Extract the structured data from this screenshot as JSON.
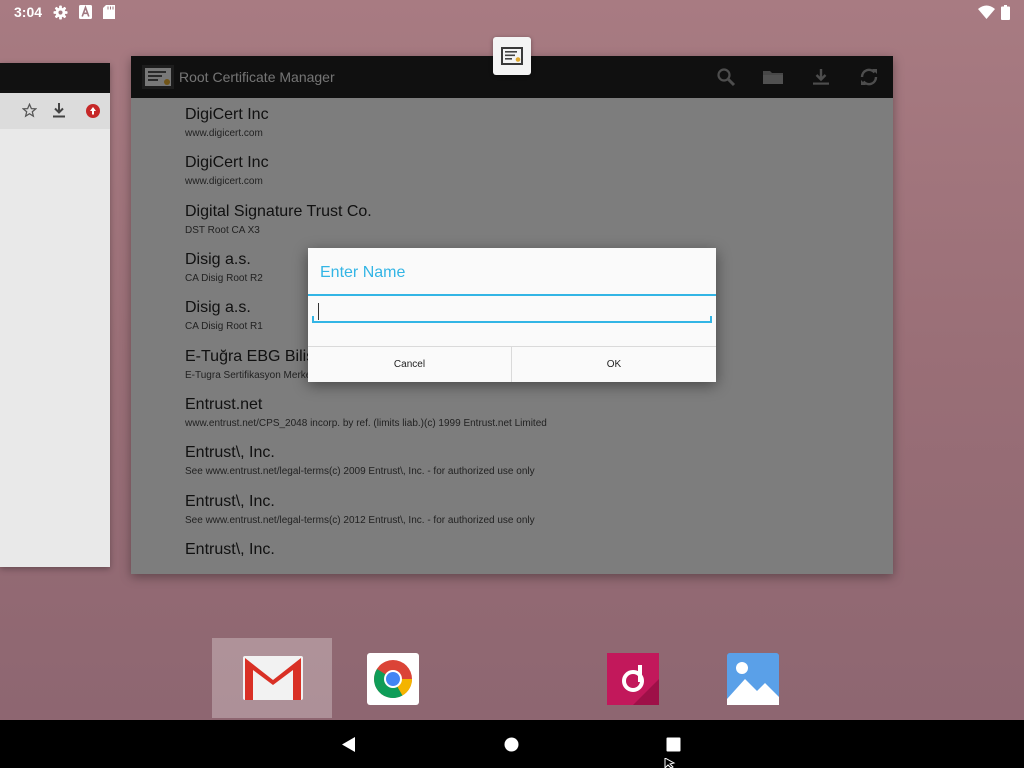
{
  "status_bar": {
    "time": "3:04",
    "icons": [
      "settings-icon",
      "keyboard-a-icon",
      "sd-card-icon",
      "wifi-icon",
      "battery-icon"
    ]
  },
  "background_window": {
    "icons": [
      "star-icon",
      "download-icon",
      "security-alert-icon"
    ]
  },
  "app": {
    "title": "Root Certificate Manager",
    "toolbar_icons": [
      "search-icon",
      "folder-icon",
      "download-icon",
      "refresh-icon"
    ],
    "certificates": [
      {
        "name": "DigiCert Inc",
        "detail": "www.digicert.com"
      },
      {
        "name": "DigiCert Inc",
        "detail": "www.digicert.com"
      },
      {
        "name": "Digital Signature Trust Co.",
        "detail": "DST Root CA X3"
      },
      {
        "name": "Disig a.s.",
        "detail": "CA Disig Root R2"
      },
      {
        "name": "Disig a.s.",
        "detail": "CA Disig Root R1"
      },
      {
        "name": "E-Tuğra EBG Bilişim Teknolojileri ve Hizmetleri A.Ş.",
        "detail": "E-Tugra Sertifikasyon Merkezi"
      },
      {
        "name": "Entrust.net",
        "detail": "www.entrust.net/CPS_2048 incorp. by ref. (limits liab.)(c) 1999 Entrust.net Limited"
      },
      {
        "name": "Entrust\\, Inc.",
        "detail": "See www.entrust.net/legal-terms(c) 2009 Entrust\\, Inc. - for authorized use only"
      },
      {
        "name": "Entrust\\, Inc.",
        "detail": "See www.entrust.net/legal-terms(c) 2012 Entrust\\, Inc. - for authorized use only"
      },
      {
        "name": "Entrust\\, Inc.",
        "detail": ""
      }
    ]
  },
  "dialog": {
    "title": "Enter Name",
    "input_value": "",
    "cancel_label": "Cancel",
    "ok_label": "OK"
  },
  "dock": {
    "apps": [
      "gmail-icon",
      "chrome-icon",
      "music-icon",
      "gallery-icon"
    ]
  },
  "nav_bar": {
    "buttons": [
      "back-icon",
      "home-icon",
      "recents-icon"
    ]
  },
  "colors": {
    "accent": "#33b5e5",
    "wallpaper": "#9a6f77",
    "app_bar": "#202020"
  }
}
